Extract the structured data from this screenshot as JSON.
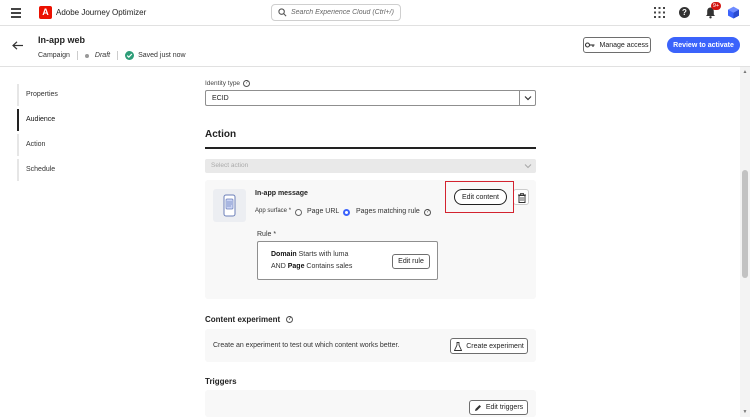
{
  "app": {
    "logo_letter": "A",
    "name": "Adobe Journey Optimizer"
  },
  "search": {
    "placeholder": "Search Experience Cloud (Ctrl+/)"
  },
  "topbar": {
    "notification_count": "9+"
  },
  "header": {
    "title": "In-app web",
    "type": "Campaign",
    "status": "Draft",
    "save_state": "Saved just now",
    "manage_access_label": "Manage access",
    "review_label": "Review to activate"
  },
  "nav": {
    "items": [
      {
        "label": "Properties"
      },
      {
        "label": "Audience"
      },
      {
        "label": "Action"
      },
      {
        "label": "Schedule"
      }
    ]
  },
  "identity": {
    "label": "Identity type",
    "value": "ECID"
  },
  "action": {
    "title": "Action",
    "select_placeholder": "Select action",
    "card": {
      "title": "In-app message",
      "surface_label": "App surface",
      "required_mark": "*",
      "option_page_url": "Page URL",
      "option_pages_matching": "Pages matching rule",
      "edit_content_label": "Edit content",
      "rule_label": "Rule *",
      "rule_line1_bold": "Domain",
      "rule_line1_rest": " Starts with luma",
      "rule_line2_and": "AND ",
      "rule_line2_bold": "Page",
      "rule_line2_rest": " Contains sales",
      "edit_rule_label": "Edit rule"
    }
  },
  "experiment": {
    "title": "Content experiment",
    "text": "Create an experiment to test out which content works better.",
    "button_label": "Create experiment"
  },
  "triggers": {
    "title": "Triggers",
    "button_label": "Edit triggers"
  },
  "colors": {
    "accent": "#3b63fb",
    "brand": "#eb1000",
    "highlight": "#d3232f",
    "success": "#2d9d78"
  }
}
